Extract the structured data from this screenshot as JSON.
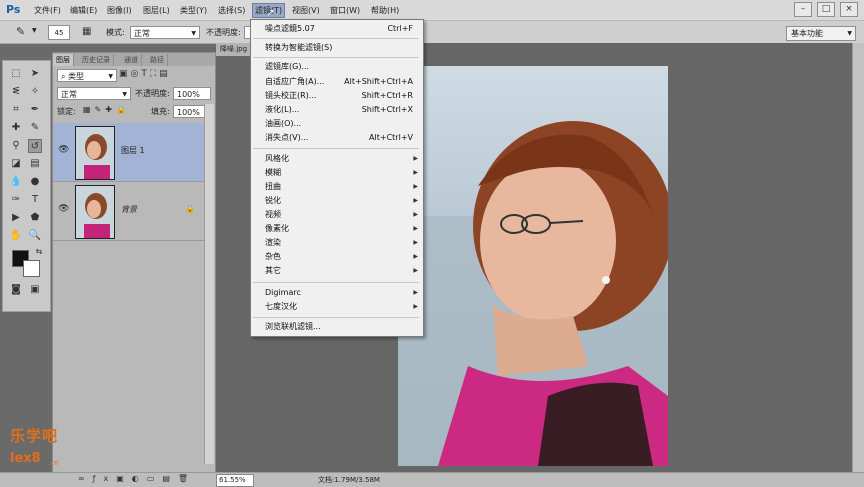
{
  "menubar": {
    "logo": "Ps",
    "items": [
      "文件(F)",
      "编辑(E)",
      "图像(I)",
      "图层(L)",
      "类型(Y)",
      "选择(S)",
      "滤镜(T)",
      "视图(V)",
      "窗口(W)",
      "帮助(H)"
    ]
  },
  "window_controls": {
    "minimize": "–",
    "restore": "□",
    "close": "×"
  },
  "options": {
    "brush_size": "45",
    "mode_label": "模式:",
    "mode_value": "正常",
    "opacity_label": "不透明度:",
    "workspace": "基本功能"
  },
  "layers_panel": {
    "tabs": [
      "图层",
      "历史记录",
      "通道",
      "路径"
    ],
    "filter_kind": "类型",
    "blend_mode": "正常",
    "opacity_label": "不透明度:",
    "opacity_value": "100%",
    "lock_label": "锁定:",
    "fill_label": "填充:",
    "fill_value": "100%",
    "layers": [
      {
        "name": "图层 1",
        "selected": true
      },
      {
        "name": "背景",
        "locked": true
      }
    ]
  },
  "document": {
    "tab_title": "降噪.jpg"
  },
  "status": {
    "zoom": "61.55%",
    "doc_info": "文档:1.79M/3.58M"
  },
  "filter_menu": {
    "last_filter": "噪点滤鏡5.07",
    "last_filter_shortcut": "Ctrl+F",
    "convert_smart": "转换为智能滤镜(S)",
    "gallery": "滤镜库(G)...",
    "adaptive_wide": "自适应广角(A)...",
    "adaptive_wide_shortcut": "Alt+Shift+Ctrl+A",
    "lens_correction": "镜头校正(R)...",
    "lens_correction_shortcut": "Shift+Ctrl+R",
    "liquify": "液化(L)...",
    "liquify_shortcut": "Shift+Ctrl+X",
    "oil_paint": "油画(O)...",
    "vanishing_point": "消失点(V)...",
    "vanishing_point_shortcut": "Alt+Ctrl+V",
    "submenus": [
      "风格化",
      "模糊",
      "扭曲",
      "锐化",
      "视频",
      "像素化",
      "渲染",
      "杂色",
      "其它"
    ],
    "plugins": [
      "Digimarc",
      "七度汉化"
    ],
    "browse_online": "浏览联机滤镜..."
  },
  "watermark": {
    "line1": "乐学吧",
    "line2": "lex8",
    "line3": ".cn"
  },
  "colors": {
    "menu_highlight": "#98a9c8",
    "layer_selected": "#a3b3d6",
    "watermark": "#e46f19"
  }
}
